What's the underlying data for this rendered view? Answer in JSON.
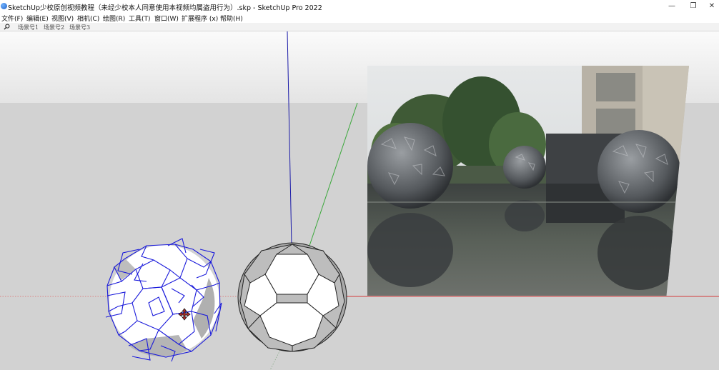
{
  "window": {
    "title": "SketchUp少校原创视频教程（未经少校本人同意使用本视频均属盗用行为）.skp - SketchUp Pro 2022",
    "controls": {
      "minimize": "—",
      "restore": "❐",
      "close": "✕"
    }
  },
  "menu": [
    "文件(F)",
    "编辑(E)",
    "视图(V)",
    "相机(C)",
    "绘图(R)",
    "工具(T)",
    "窗口(W)",
    "扩展程序 (x)",
    "帮助(H)"
  ],
  "scenes": [
    "场景号1",
    "场景号2",
    "场景号3"
  ],
  "icons": {
    "search": "search-icon",
    "app": "sketchup-logo-icon",
    "cursor": "move-cursor-icon"
  },
  "colors": {
    "blue_axis": "#1a1aa8",
    "green_axis": "#3aa83a",
    "red_axis": "#d43a3a",
    "selection": "#1a1adb"
  }
}
